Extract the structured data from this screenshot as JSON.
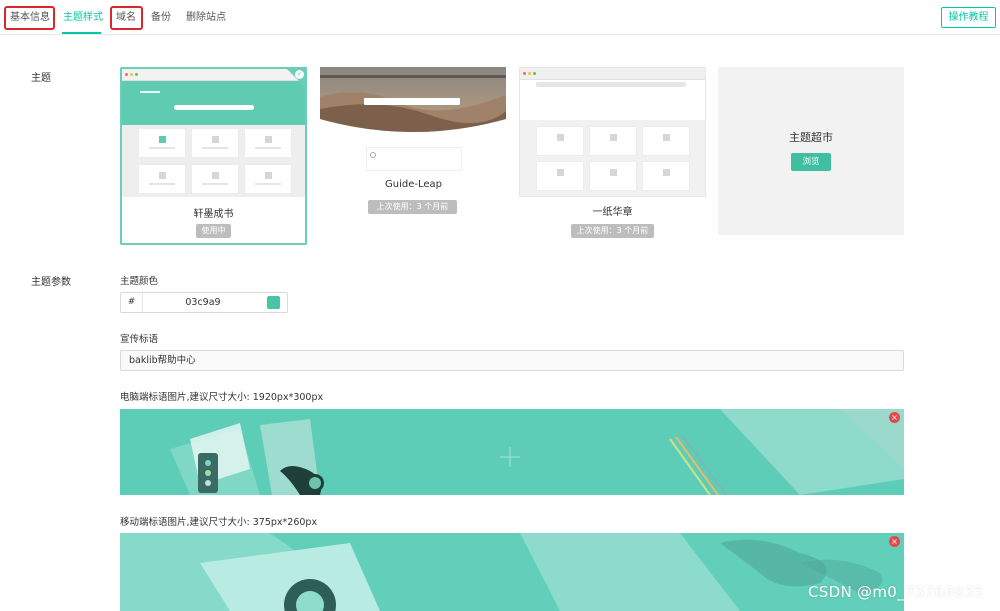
{
  "tabs": [
    {
      "label": "基本信息"
    },
    {
      "label": "主题样式"
    },
    {
      "label": "域名"
    },
    {
      "label": "备份"
    },
    {
      "label": "删除站点"
    }
  ],
  "tutorial_button": "操作教程",
  "theme_section": {
    "label": "主题",
    "cards": [
      {
        "name": "轩墨成书",
        "badge": "使用中",
        "selected": true
      },
      {
        "name": "Guide-Leap",
        "badge": "上次使用：3 个月前",
        "selected": false
      },
      {
        "name": "一纸华章",
        "badge": "上次使用：3 个月前",
        "selected": false
      }
    ],
    "market": {
      "title": "主题超市",
      "button": "浏览"
    }
  },
  "params_section": {
    "label": "主题参数",
    "color_label": "主题颜色",
    "color_prefix": "#",
    "color_value": "03c9a9",
    "slogan_label": "宣传标语",
    "slogan_value": "baklib帮助中心",
    "pc_banner_label": "电脑端标语图片,建议尺寸大小: 1920px*300px",
    "mobile_banner_label": "移动端标语图片,建议尺寸大小: 375px*260px",
    "delete_icon_glyph": "×"
  },
  "watermark": "CSDN @m0_73766935",
  "colors": {
    "accent": "#03c9a9",
    "theme_swatch": "#47c4a4",
    "highlight_box": "#d9272e",
    "banner": "#5ecdb8"
  }
}
